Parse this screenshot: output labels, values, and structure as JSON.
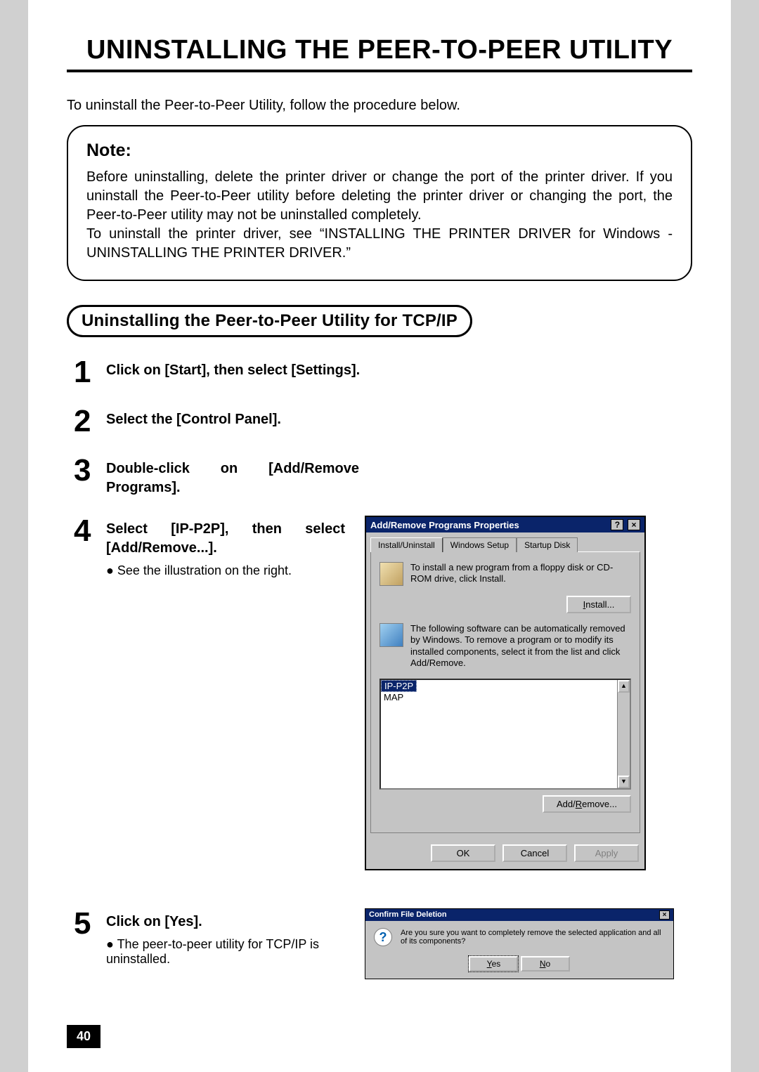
{
  "title": "UNINSTALLING THE PEER-TO-PEER UTILITY",
  "intro": "To uninstall the Peer-to-Peer Utility, follow the procedure below.",
  "note": {
    "head": "Note:",
    "body": "Before uninstalling, delete the printer driver or change the port of the printer driver.  If you uninstall the Peer-to-Peer utility before deleting the printer driver or changing the port, the Peer-to-Peer utility may not be uninstalled completely.\nTo uninstall the printer driver, see “INSTALLING THE PRINTER DRIVER for Windows - UNINSTALLING THE PRINTER DRIVER.”"
  },
  "section_heading": "Uninstalling the Peer-to-Peer Utility for TCP/IP",
  "steps": {
    "s1": {
      "num": "1",
      "text": "Click on [Start], then select [Settings]."
    },
    "s2": {
      "num": "2",
      "text": "Select the [Control Panel]."
    },
    "s3": {
      "num": "3",
      "text": "Double-click on [Add/Remove Programs]."
    },
    "s4": {
      "num": "4",
      "text": "Select [IP-P2P], then select [Add/Remove...].",
      "sub": "See the illustration on the right."
    },
    "s5": {
      "num": "5",
      "text": "Click on [Yes].",
      "sub": "The peer-to-peer utility for TCP/IP is uninstalled."
    }
  },
  "dialog": {
    "title": "Add/Remove Programs Properties",
    "help_glyph": "?",
    "close_glyph": "×",
    "tabs": {
      "t1": "Install/Uninstall",
      "t2": "Windows Setup",
      "t3": "Startup Disk"
    },
    "install_text": "To install a new program from a floppy disk or CD-ROM drive, click Install.",
    "install_btn": "Install...",
    "remove_text": "The following software can be automatically removed by Windows. To remove a program or to modify its installed components, select it from the list and click Add/Remove.",
    "list": {
      "sel": "IP-P2P",
      "item2": "MAP"
    },
    "addremove_btn": "Add/Remove...",
    "ok": "OK",
    "cancel": "Cancel",
    "apply": "Apply"
  },
  "confirm": {
    "title": "Confirm File Deletion",
    "close_glyph": "×",
    "msg": "Are you sure you want to completely remove the selected application and all of its components?",
    "yes": "Yes",
    "no": "No"
  },
  "page_number": "40"
}
